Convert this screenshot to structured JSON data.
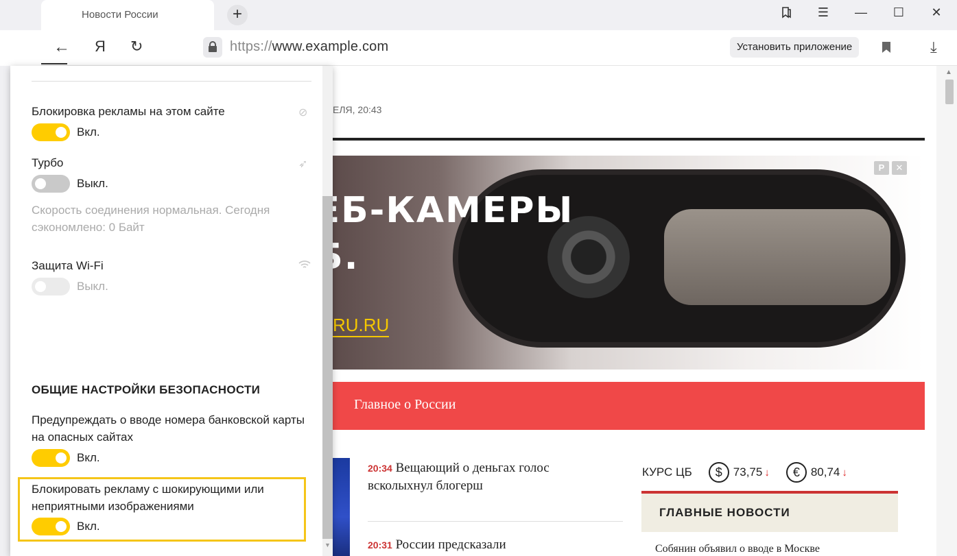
{
  "browser": {
    "tab_title": "Новости России",
    "tab_close": "✕",
    "new_tab": "+",
    "url_protocol": "https://",
    "url_host": "www.example.com",
    "install_app_label": "Установить приложение",
    "yandex_button": "Я"
  },
  "page": {
    "date_fragment": "ЕЛЯ, 20:43",
    "banner": {
      "line1": "ВЕБ-КАМЕРЫ",
      "line2": "УБ.",
      "link": "RU.RU",
      "ad_badge_1": "Р",
      "ad_badge_2": "✕"
    },
    "section_title": "Главное о России",
    "news": [
      {
        "time": "20:34",
        "title": "Вещающий о деньгах голос всколыхнул блогерш"
      },
      {
        "time": "20:31",
        "title": "России предсказали неожиданные"
      }
    ],
    "currency": {
      "label": "КУРС ЦБ",
      "usd_sign": "$",
      "usd_value": "73,75",
      "eur_sign": "€",
      "eur_value": "80,74",
      "trend_icon": "↓"
    },
    "main_news": {
      "header": "ГЛАВНЫЕ НОВОСТИ",
      "first_item": "Собянин объявил о вводе в Москве"
    }
  },
  "popup": {
    "ad_block_label": "Блокировка рекламы на этом сайте",
    "ad_block_state": "Вкл.",
    "turbo_label": "Турбо",
    "turbo_state": "Выкл.",
    "turbo_info": "Скорость соединения нормальная. Сегодня сэкономлено: 0 Байт",
    "wifi_label": "Защита Wi-Fi",
    "wifi_state": "Выкл.",
    "security_section": "ОБЩИЕ НАСТРОЙКИ БЕЗОПАСНОСТИ",
    "card_warning_label": "Предупреждать о вводе номера банковской карты на опасных сайтах",
    "card_warning_state": "Вкл.",
    "shock_ads_label": "Блокировать рекламу с шокирующими или неприятными изображениями",
    "shock_ads_state": "Вкл."
  },
  "colors": {
    "toggle_on": "#ffcc00",
    "highlight": "#f5c518",
    "red_bar": "#f04848"
  }
}
